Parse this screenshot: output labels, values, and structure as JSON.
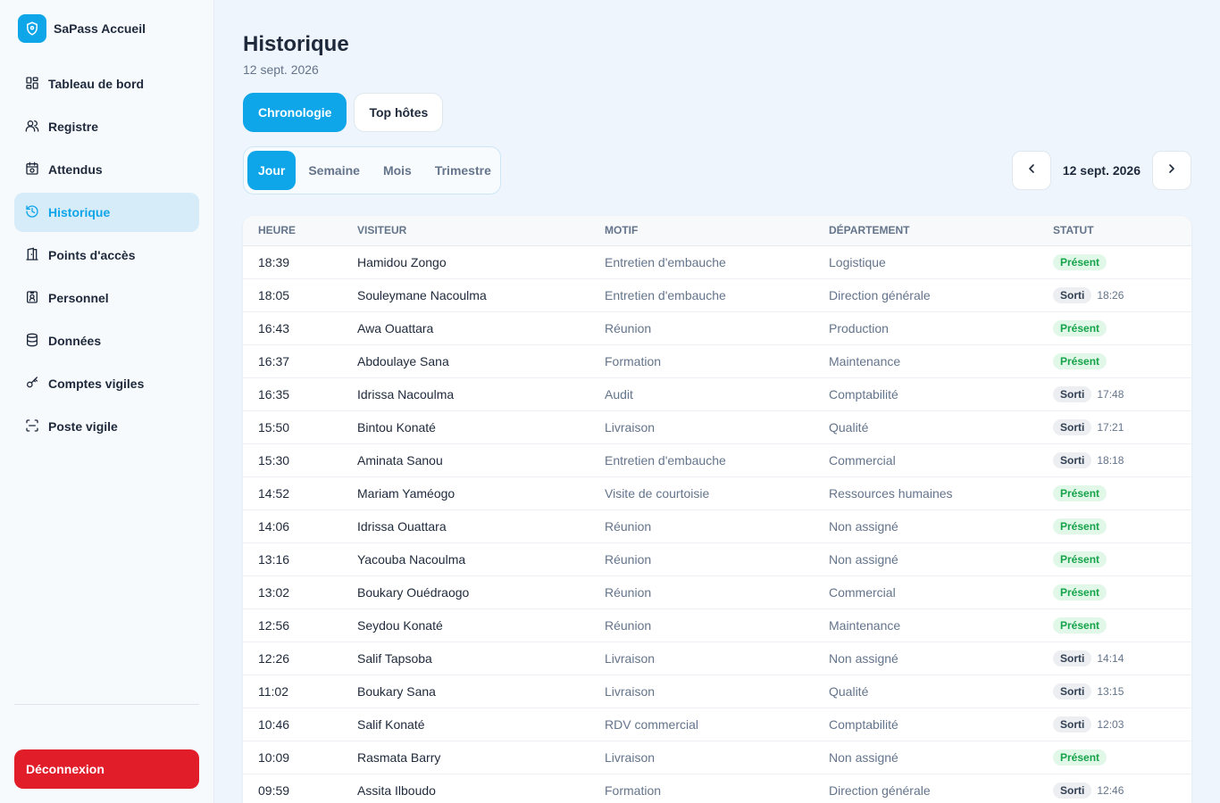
{
  "app": {
    "name": "SaPass Accueil"
  },
  "sidebar": {
    "items": [
      {
        "label": "Tableau de bord",
        "icon": "dashboard-icon"
      },
      {
        "label": "Registre",
        "icon": "users-icon"
      },
      {
        "label": "Attendus",
        "icon": "calendar-clock-icon"
      },
      {
        "label": "Historique",
        "icon": "history-icon",
        "active": true
      },
      {
        "label": "Points d'accès",
        "icon": "door-icon"
      },
      {
        "label": "Personnel",
        "icon": "id-badge-icon"
      },
      {
        "label": "Données",
        "icon": "database-icon"
      },
      {
        "label": "Comptes vigiles",
        "icon": "key-icon"
      },
      {
        "label": "Poste vigile",
        "icon": "scan-icon"
      }
    ],
    "logout_label": "Déconnexion"
  },
  "page": {
    "title": "Historique",
    "subtitle": "12 sept. 2026",
    "view_tabs": [
      "Chronologie",
      "Top hôtes"
    ],
    "active_view": "Chronologie",
    "periods": [
      "Jour",
      "Semaine",
      "Mois",
      "Trimestre"
    ],
    "active_period": "Jour",
    "current_date": "12 sept. 2026"
  },
  "table": {
    "columns": [
      "HEURE",
      "VISITEUR",
      "MOTIF",
      "DÉPARTEMENT",
      "STATUT"
    ],
    "rows": [
      {
        "time": "18:39",
        "visitor": "Hamidou Zongo",
        "reason": "Entretien d'embauche",
        "department": "Logistique",
        "status": "Présent",
        "exit": ""
      },
      {
        "time": "18:05",
        "visitor": "Souleymane Nacoulma",
        "reason": "Entretien d'embauche",
        "department": "Direction générale",
        "status": "Sorti",
        "exit": "18:26"
      },
      {
        "time": "16:43",
        "visitor": "Awa Ouattara",
        "reason": "Réunion",
        "department": "Production",
        "status": "Présent",
        "exit": ""
      },
      {
        "time": "16:37",
        "visitor": "Abdoulaye Sana",
        "reason": "Formation",
        "department": "Maintenance",
        "status": "Présent",
        "exit": ""
      },
      {
        "time": "16:35",
        "visitor": "Idrissa Nacoulma",
        "reason": "Audit",
        "department": "Comptabilité",
        "status": "Sorti",
        "exit": "17:48"
      },
      {
        "time": "15:50",
        "visitor": "Bintou Konaté",
        "reason": "Livraison",
        "department": "Qualité",
        "status": "Sorti",
        "exit": "17:21"
      },
      {
        "time": "15:30",
        "visitor": "Aminata Sanou",
        "reason": "Entretien d'embauche",
        "department": "Commercial",
        "status": "Sorti",
        "exit": "18:18"
      },
      {
        "time": "14:52",
        "visitor": "Mariam Yaméogo",
        "reason": "Visite de courtoisie",
        "department": "Ressources humaines",
        "status": "Présent",
        "exit": ""
      },
      {
        "time": "14:06",
        "visitor": "Idrissa Ouattara",
        "reason": "Réunion",
        "department": "Non assigné",
        "status": "Présent",
        "exit": ""
      },
      {
        "time": "13:16",
        "visitor": "Yacouba Nacoulma",
        "reason": "Réunion",
        "department": "Non assigné",
        "status": "Présent",
        "exit": ""
      },
      {
        "time": "13:02",
        "visitor": "Boukary Ouédraogo",
        "reason": "Réunion",
        "department": "Commercial",
        "status": "Présent",
        "exit": ""
      },
      {
        "time": "12:56",
        "visitor": "Seydou Konaté",
        "reason": "Réunion",
        "department": "Maintenance",
        "status": "Présent",
        "exit": ""
      },
      {
        "time": "12:26",
        "visitor": "Salif Tapsoba",
        "reason": "Livraison",
        "department": "Non assigné",
        "status": "Sorti",
        "exit": "14:14"
      },
      {
        "time": "11:02",
        "visitor": "Boukary Sana",
        "reason": "Livraison",
        "department": "Qualité",
        "status": "Sorti",
        "exit": "13:15"
      },
      {
        "time": "10:46",
        "visitor": "Salif Konaté",
        "reason": "RDV commercial",
        "department": "Comptabilité",
        "status": "Sorti",
        "exit": "12:03"
      },
      {
        "time": "10:09",
        "visitor": "Rasmata Barry",
        "reason": "Livraison",
        "department": "Non assigné",
        "status": "Présent",
        "exit": ""
      },
      {
        "time": "09:59",
        "visitor": "Assita Ilboudo",
        "reason": "Formation",
        "department": "Direction générale",
        "status": "Sorti",
        "exit": "12:46"
      }
    ]
  },
  "colors": {
    "accent": "#0ea5e9",
    "danger": "#e11d2a",
    "present_bg": "#e1f8e9",
    "present_text": "#16a34a",
    "sorti_bg": "#eceef1"
  }
}
